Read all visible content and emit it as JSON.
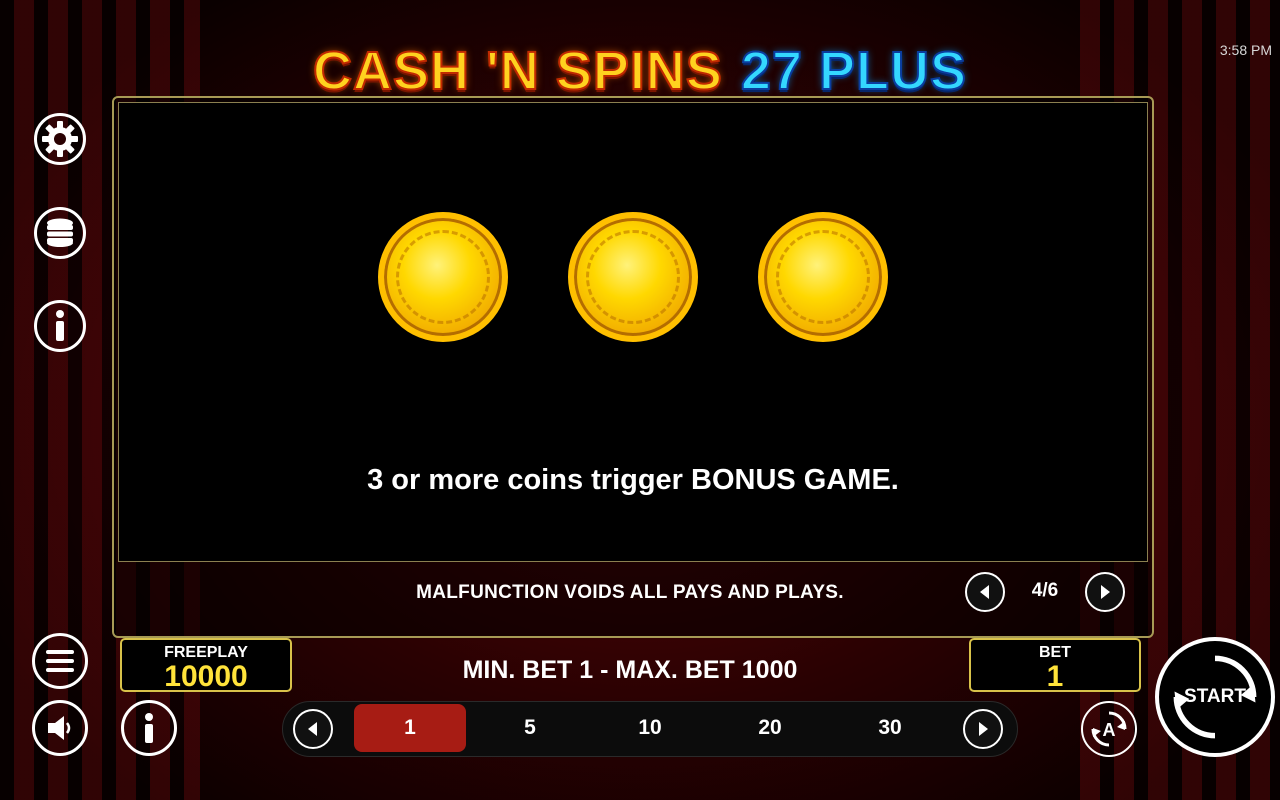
{
  "header": {
    "title_part1": "CASH 'N SPINS",
    "title_part2": "27 PLUS",
    "clock": "3:58 PM"
  },
  "left_toolbar": {
    "icons": [
      "gear-icon",
      "coin-stack-icon",
      "info-icon",
      "menu-icon",
      "speaker-icon"
    ]
  },
  "paytable": {
    "symbols": [
      "gold-coin",
      "gold-coin",
      "gold-coin"
    ],
    "description": "3 or more coins trigger BONUS GAME.",
    "disclaimer": "MALFUNCTION VOIDS ALL PAYS AND PLAYS.",
    "page": "4/6"
  },
  "balance": {
    "label": "FREEPLAY",
    "value": "10000"
  },
  "limits": {
    "text": "MIN. BET 1 - MAX. BET 1000"
  },
  "bet": {
    "label": "BET",
    "value": "1",
    "options": [
      "1",
      "5",
      "10",
      "20",
      "30"
    ],
    "selected_index": 0
  },
  "controls": {
    "start_label": "START",
    "autoplay_label": "A"
  },
  "colors": {
    "gold_text": "#ffe33a",
    "selected_bet": "#a71c14",
    "frame_border": "#a79a55"
  }
}
